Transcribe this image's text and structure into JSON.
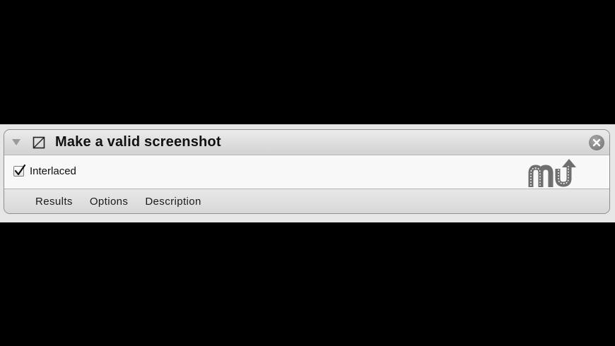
{
  "action": {
    "title": "Make a valid screenshot",
    "icon": "crop-frame-icon",
    "collapse_icon": "disclosure-triangle-icon",
    "close_icon": "close-circle-icon"
  },
  "options": {
    "interlaced_label": "Interlaced",
    "interlaced_checked": true
  },
  "watermark": {
    "icon": "macupdate-logo-icon"
  },
  "tabs": [
    {
      "label": "Results"
    },
    {
      "label": "Options"
    },
    {
      "label": "Description"
    }
  ],
  "colors": {
    "background": "#000000",
    "panel": "#f7f7f7",
    "titlebar": "#dcdcdc",
    "logo": "#6f6f6f"
  }
}
